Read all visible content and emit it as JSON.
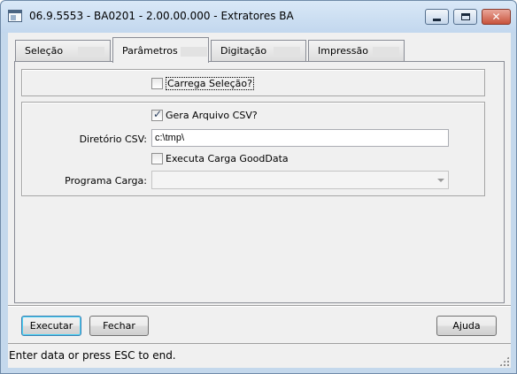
{
  "window": {
    "title": "06.9.5553 - BA0201 - 2.00.00.000 - Extratores BA"
  },
  "tabs": [
    {
      "label": "Seleção",
      "active": false
    },
    {
      "label": "Parâmetros",
      "active": true
    },
    {
      "label": "Digitação",
      "active": false
    },
    {
      "label": "Impressão",
      "active": false
    }
  ],
  "parametros": {
    "carrega_selecao": {
      "label": "Carrega Seleção?",
      "checked": false
    },
    "gera_csv": {
      "label": "Gera Arquivo CSV?",
      "checked": true
    },
    "diretorio_csv": {
      "label": "Diretório CSV:",
      "value": "c:\\tmp\\"
    },
    "executa_carga": {
      "label": "Executa Carga GoodData",
      "checked": false
    },
    "programa_carga": {
      "label": "Programa Carga:",
      "value": ""
    }
  },
  "buttons": {
    "executar": "Executar",
    "fechar": "Fechar",
    "ajuda": "Ajuda"
  },
  "status": {
    "text": "Enter data or press ESC to end."
  },
  "colors": {
    "frame": "#c4d8ec",
    "client": "#f0f0f0",
    "default_button_border": "#3c7fb1"
  }
}
